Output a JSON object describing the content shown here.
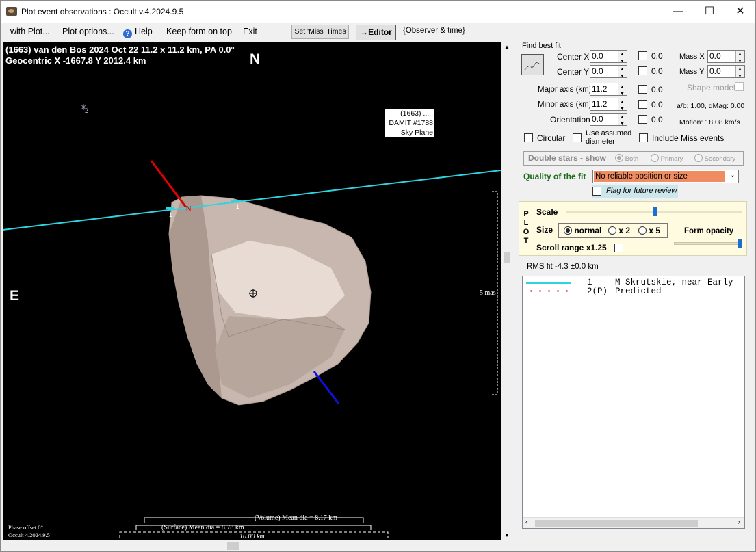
{
  "window": {
    "title": "Plot event observations : Occult v.4.2024.9.5",
    "minimize": "—",
    "maximize": "☐",
    "close": "✕"
  },
  "menu": {
    "with_plot": "with Plot...",
    "plot_options": "Plot options...",
    "help": "Help",
    "keep_on_top": "Keep form on top",
    "exit": "Exit",
    "set_miss_times": "Set 'Miss' Times",
    "editor": "→Editor",
    "observer_time": "{Observer & time}"
  },
  "plot": {
    "header_line1": "(1663) van den Bos  2024 Oct 22   11.2 x 11.2 km, PA 0.0°",
    "header_line2": "Geocentric  X  -1667.8  Y 2012.4 km",
    "north": "N",
    "east": "E",
    "star_label": "2",
    "shape_label_1": "(1663) .....",
    "shape_label_2": "DAMIT #1788",
    "shape_label_3": "Sky Plane",
    "chord_label_1": "1",
    "chord_label_2": "1",
    "pole_label": "N",
    "scale_mas": "5 mas",
    "volume_dia": "(Volume) Mean dia = 8.17 km",
    "surface_dia": "(Surface) Mean dia = 8.78 km",
    "scale_km": "10.00 km",
    "phase_offset": "Phase offset 0°",
    "occult_version": "Occult 4.2024.9.5"
  },
  "fit": {
    "group_label": "Find best fit",
    "center_x_label": "Center X",
    "center_x": "0.0",
    "center_x_step": "0.0",
    "center_y_label": "Center Y",
    "center_y": "0.0",
    "center_y_step": "0.0",
    "mass_x_label": "Mass X",
    "mass_x": "0.0",
    "mass_y_label": "Mass Y",
    "mass_y": "0.0",
    "major_label": "Major axis (km)",
    "major": "11.2",
    "major_step": "0.0",
    "minor_label": "Minor axis (km)",
    "minor": "11.2",
    "minor_step": "0.0",
    "orientation_label": "Orientation",
    "orientation": "0.0",
    "orientation_step": "0.0",
    "shape_model": "Shape model",
    "ab_dmag": "a/b: 1.00, dMag: 0.00",
    "motion": "Motion: 18.08 km/s",
    "circular": "Circular",
    "use_assumed_1": "Use assumed",
    "use_assumed_2": "diameter",
    "include_miss": "Include Miss events"
  },
  "double_stars": {
    "label": "Double stars - show",
    "both": "Both",
    "primary": "Primary",
    "secondary": "Secondary"
  },
  "quality": {
    "label": "Quality of the fit",
    "value": "No reliable position or size",
    "flag_review": "Flag for future review"
  },
  "plot_panel": {
    "vertical_label": [
      "P",
      "L",
      "O",
      "T"
    ],
    "scale": "Scale",
    "size": "Size",
    "normal": "normal",
    "x2": "x 2",
    "x5": "x 5",
    "form_opacity": "Form opacity",
    "scroll_range": "Scroll range x1.25"
  },
  "rms_fit": "RMS fit -4.3 ±0.0 km",
  "observers": [
    {
      "num": "1",
      "text": "M Skrutskie, near Early"
    },
    {
      "num": "2(P)",
      "text": "Predicted"
    }
  ],
  "colors": {
    "chord": "#2fd4e0",
    "predicted": "#e36fa0",
    "quality_bg": "#f08c62",
    "pole_north": "#e00000",
    "pole_south": "#1010e0"
  }
}
